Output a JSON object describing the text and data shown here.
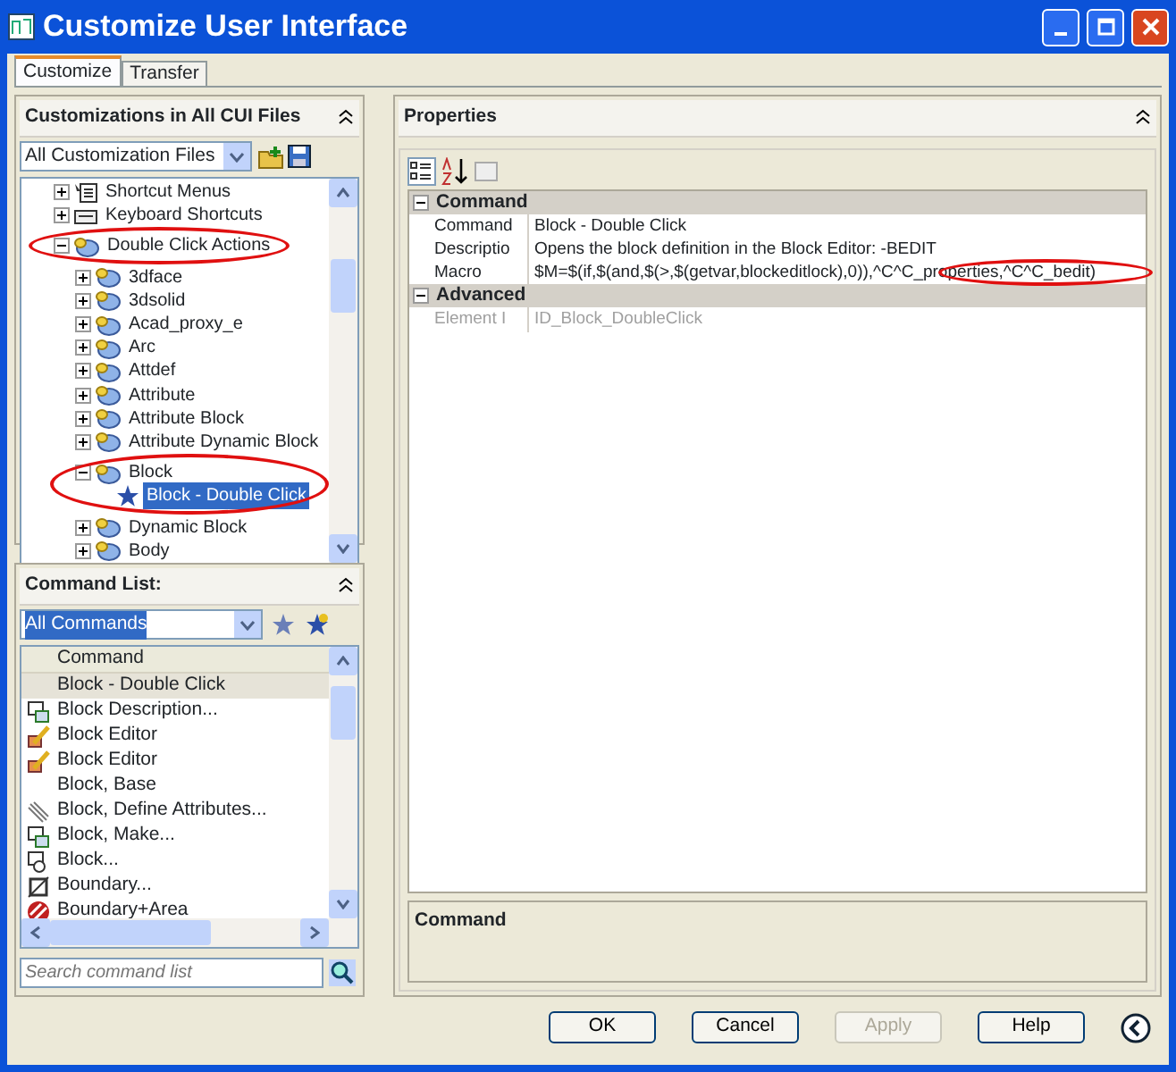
{
  "window": {
    "title": "Customize User Interface"
  },
  "tabs": [
    {
      "label": "Customize",
      "selected": true
    },
    {
      "label": "Transfer",
      "selected": false
    }
  ],
  "customizations_panel": {
    "title": "Customizations in All CUI Files",
    "filter": "All Customization Files",
    "tree": [
      {
        "label": "Shortcut Menus",
        "kind": "menu",
        "expanded": false,
        "selected": false,
        "circled": false
      },
      {
        "label": "Keyboard Shortcuts",
        "kind": "keyboard",
        "expanded": false,
        "selected": false,
        "circled": false
      },
      {
        "label": "Double Click Actions",
        "kind": "action",
        "expanded": true,
        "selected": false,
        "circled": true,
        "children": [
          {
            "label": "3dface",
            "kind": "action",
            "expanded": false,
            "selected": false,
            "circled": false
          },
          {
            "label": "3dsolid",
            "kind": "action",
            "expanded": false,
            "selected": false,
            "circled": false
          },
          {
            "label": "Acad_proxy_e",
            "kind": "action",
            "expanded": false,
            "selected": false,
            "circled": false
          },
          {
            "label": "Arc",
            "kind": "action",
            "expanded": false,
            "selected": false,
            "circled": false
          },
          {
            "label": "Attdef",
            "kind": "action",
            "expanded": false,
            "selected": false,
            "circled": false
          },
          {
            "label": "Attribute",
            "kind": "action",
            "expanded": false,
            "selected": false,
            "circled": false
          },
          {
            "label": "Attribute Block",
            "kind": "action",
            "expanded": false,
            "selected": false,
            "circled": false
          },
          {
            "label": "Attribute Dynamic Block",
            "kind": "action",
            "expanded": false,
            "selected": false,
            "circled": false
          },
          {
            "label": "Block",
            "kind": "action",
            "expanded": true,
            "selected": false,
            "circled": true,
            "children": [
              {
                "label": "Block - Double Click",
                "kind": "star",
                "selected": true,
                "circled": false
              }
            ]
          },
          {
            "label": "Dynamic Block",
            "kind": "action",
            "expanded": false,
            "selected": false,
            "circled": false
          },
          {
            "label": "Body",
            "kind": "action",
            "expanded": false,
            "selected": false,
            "circled": false
          }
        ]
      }
    ]
  },
  "command_list_panel": {
    "title": "Command List:",
    "filter": "All Commands",
    "column": "Command",
    "commands": [
      {
        "label": "Block - Double Click",
        "kind": "none",
        "selected": true
      },
      {
        "label": "Block Description...",
        "kind": "block",
        "selected": false
      },
      {
        "label": "Block Editor",
        "kind": "editor",
        "selected": false
      },
      {
        "label": "Block Editor",
        "kind": "editor",
        "selected": false
      },
      {
        "label": "Block, Base",
        "kind": "none",
        "selected": false
      },
      {
        "label": "Block, Define Attributes...",
        "kind": "attribute",
        "selected": false
      },
      {
        "label": "Block, Make...",
        "kind": "block",
        "selected": false
      },
      {
        "label": "Block...",
        "kind": "insert",
        "selected": false
      },
      {
        "label": "Boundary...",
        "kind": "boundary",
        "selected": false
      },
      {
        "label": "Boundary+Area",
        "kind": "hatch",
        "selected": false
      }
    ],
    "search": {
      "placeholder": "Search command list"
    }
  },
  "properties_panel": {
    "title": "Properties",
    "categories": [
      {
        "name": "Command",
        "expanded": true,
        "properties": [
          {
            "name": "Command",
            "value": "Block - Double Click",
            "disabled": false,
            "circled": false
          },
          {
            "name": "Descriptio",
            "value": "Opens the block definition in the Block Editor: -BEDIT",
            "disabled": false,
            "circled": false
          },
          {
            "name": "Macro",
            "value": "$M=$(if,$(and,$(>,$(getvar,blockeditlock),0)),^C^C_properties,^C^C_bedit)",
            "disabled": false,
            "circled": true
          }
        ]
      },
      {
        "name": "Advanced",
        "expanded": true,
        "properties": [
          {
            "name": "Element I",
            "value": "ID_Block_DoubleClick",
            "disabled": true,
            "circled": false
          }
        ]
      }
    ]
  },
  "help_panel": {
    "title": "Command"
  },
  "buttons": [
    {
      "label": "OK",
      "disabled": false
    },
    {
      "label": "Cancel",
      "disabled": false
    },
    {
      "label": "Apply",
      "disabled": true
    },
    {
      "label": "Help",
      "disabled": false
    }
  ]
}
